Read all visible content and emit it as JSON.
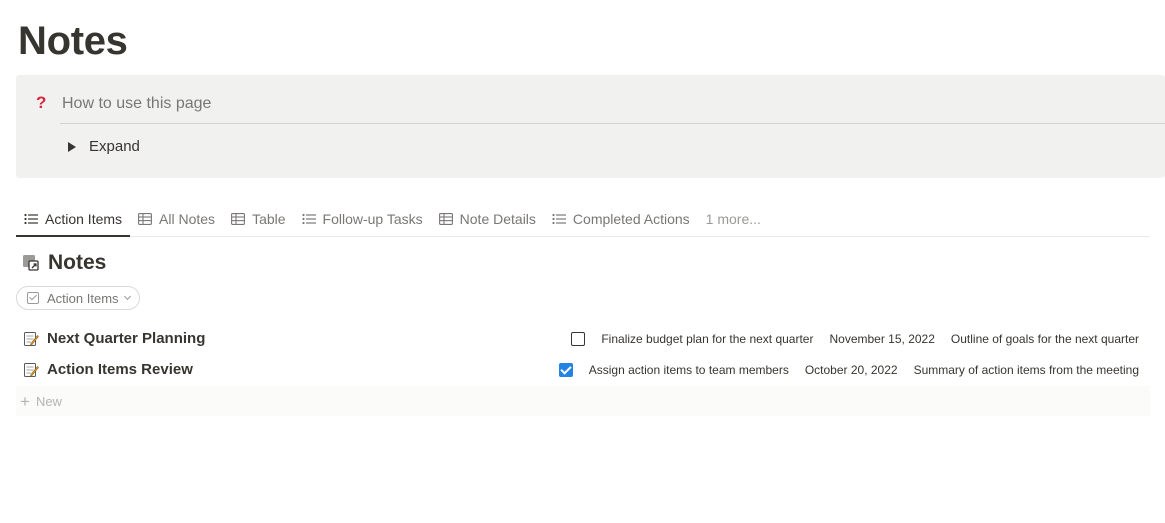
{
  "page": {
    "title": "Notes"
  },
  "callout": {
    "icon": "question-mark-icon",
    "icon_glyph": "?",
    "heading": "How to use this page",
    "toggle_label": "Expand"
  },
  "tabs": [
    {
      "label": "Action Items",
      "icon": "list-icon",
      "active": true
    },
    {
      "label": "All Notes",
      "icon": "table-icon",
      "active": false
    },
    {
      "label": "Table",
      "icon": "table-icon",
      "active": false
    },
    {
      "label": "Follow-up Tasks",
      "icon": "list-icon",
      "active": false
    },
    {
      "label": "Note Details",
      "icon": "table-icon",
      "active": false
    },
    {
      "label": "Completed Actions",
      "icon": "list-icon",
      "active": false
    }
  ],
  "tabs_more": "1 more...",
  "database": {
    "title": "Notes",
    "icon": "linked-database-icon"
  },
  "filter": {
    "label": "Action Items"
  },
  "rows": [
    {
      "title": "Next Quarter Planning",
      "icon": "memo-icon",
      "checked": false,
      "action": "Finalize budget plan for the next quarter",
      "date": "November 15, 2022",
      "summary": "Outline of goals for the next quarter"
    },
    {
      "title": "Action Items Review",
      "icon": "memo-icon",
      "checked": true,
      "action": "Assign action items to team members",
      "date": "October 20, 2022",
      "summary": "Summary of action items from the meeting"
    }
  ],
  "new_label": "New",
  "colors": {
    "text": "#37352f",
    "muted": "#787774",
    "callout_bg": "#f1f1ef",
    "accent_checkbox": "#2383e2",
    "question_mark": "#d9263f"
  }
}
